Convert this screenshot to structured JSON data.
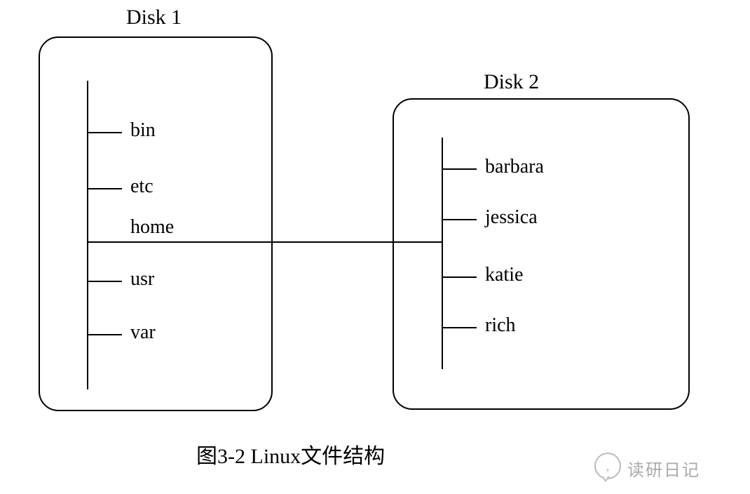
{
  "disk1": {
    "title": "Disk 1",
    "items": {
      "bin": "bin",
      "etc": "etc",
      "home": "home",
      "usr": "usr",
      "var": "var"
    }
  },
  "disk2": {
    "title": "Disk 2",
    "items": {
      "barbara": "barbara",
      "jessica": "jessica",
      "katie": "katie",
      "rich": "rich"
    }
  },
  "caption": "图3-2   Linux文件结构",
  "watermark": {
    "bubble_text": ",",
    "label": "读研日记"
  }
}
